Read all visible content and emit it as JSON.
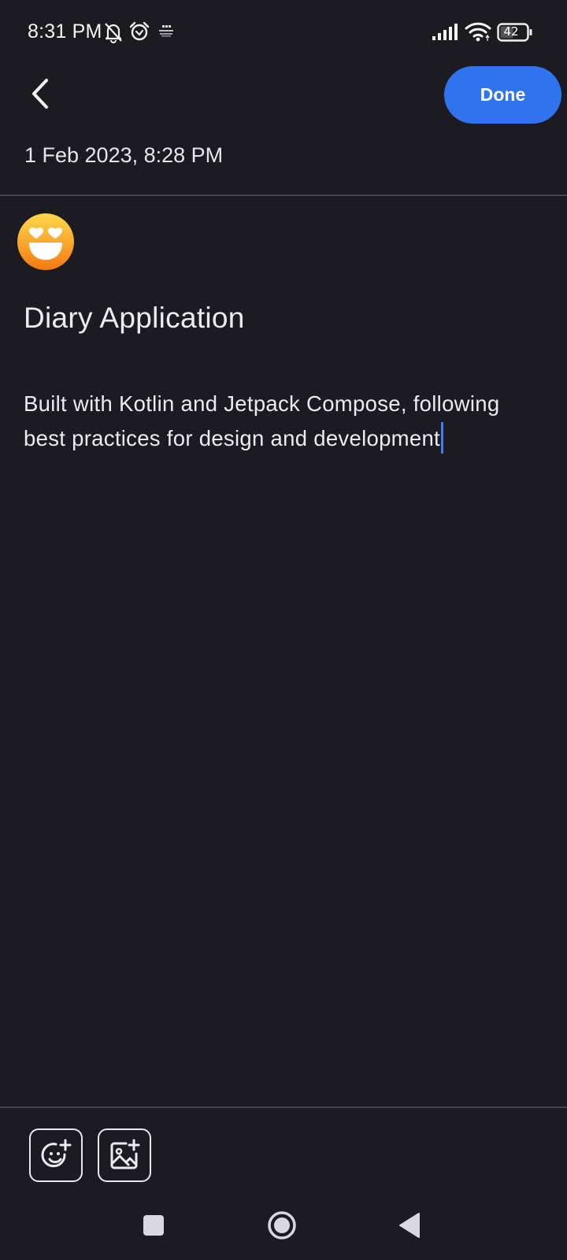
{
  "status_bar": {
    "time": "8:31 PM",
    "battery_level": "42",
    "icons": [
      "muted-bell-icon",
      "alarm-icon",
      "news-app-icon",
      "signal-icon",
      "wifi-icon",
      "battery-icon"
    ]
  },
  "header": {
    "back_icon": "chevron-left-icon",
    "done_label": "Done",
    "date": "1 Feb 2023, 8:28 PM"
  },
  "entry": {
    "mood_icon": "heart-eyes-emoji-icon",
    "title": "Diary Application",
    "body": "Built with Kotlin and Jetpack Compose, following best practices for design and development"
  },
  "toolbar": {
    "items": [
      {
        "icon": "add-mood-icon"
      },
      {
        "icon": "add-image-icon"
      }
    ]
  },
  "nav": {
    "items": [
      "recents-icon",
      "home-icon",
      "back-triangle-icon"
    ]
  },
  "colors": {
    "background": "#1c1b21",
    "accent": "#2f73ee",
    "text": "#ecebf1",
    "divider": "#46454d"
  }
}
